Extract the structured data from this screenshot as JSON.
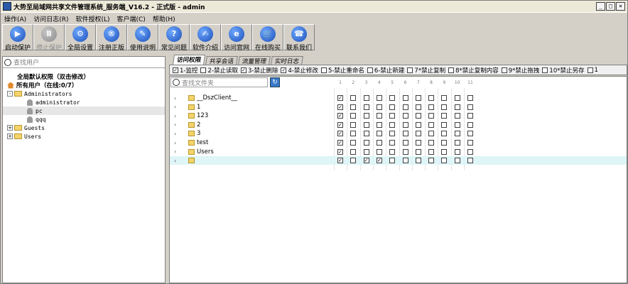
{
  "window": {
    "title": "大势至局域网共享文件管理系统_服务端_V16.2 - 正式版 - admin",
    "controls": [
      "_",
      "□",
      "×"
    ]
  },
  "menu": [
    "操作(A)",
    "访问日志(R)",
    "软件授权(L)",
    "客户端(C)",
    "帮助(H)"
  ],
  "toolbar": [
    {
      "label": "启动保护",
      "icon": "play-icon",
      "glyph": "▶",
      "enabled": true
    },
    {
      "label": "停止保护",
      "icon": "pause-icon",
      "glyph": "Ⅱ",
      "enabled": false
    },
    {
      "label": "全局设置",
      "icon": "gear-icon",
      "glyph": "⚙",
      "enabled": true
    },
    {
      "label": "注册正版",
      "icon": "registered-icon",
      "glyph": "®",
      "enabled": true
    },
    {
      "label": "使用说明",
      "icon": "graduation-cap-icon",
      "glyph": "✎",
      "enabled": true
    },
    {
      "label": "常见问题",
      "icon": "question-icon",
      "glyph": "?",
      "enabled": true
    },
    {
      "label": "软件介绍",
      "icon": "edit-icon",
      "glyph": "✍",
      "enabled": true
    },
    {
      "label": "访问官网",
      "icon": "ie-icon",
      "glyph": "e",
      "enabled": true
    },
    {
      "label": "在线购买",
      "icon": "cart-icon",
      "glyph": "🛒",
      "enabled": true
    },
    {
      "label": "联系我们",
      "icon": "phone-icon",
      "glyph": "☎",
      "enabled": true
    }
  ],
  "left": {
    "search_placeholder": "查找用户",
    "tree": [
      {
        "label": "全局默认权限（双击修改）",
        "level": 0,
        "kind": "none",
        "bold": true
      },
      {
        "label": "所有用户（在线:0/7）",
        "level": 0,
        "kind": "home",
        "bold": true
      },
      {
        "label": "Administrators",
        "level": 0,
        "kind": "folder",
        "expander": "-",
        "mono": true
      },
      {
        "label": "administrator",
        "level": 2,
        "kind": "user",
        "mono": true
      },
      {
        "label": "pc",
        "level": 2,
        "kind": "user",
        "mono": true,
        "selected": true
      },
      {
        "label": "qqq",
        "level": 2,
        "kind": "user",
        "mono": true
      },
      {
        "label": "Guests",
        "level": 0,
        "kind": "folder",
        "expander": "+",
        "mono": true
      },
      {
        "label": "Users",
        "level": 0,
        "kind": "folder",
        "expander": "+",
        "mono": true
      }
    ]
  },
  "tabs": [
    "访问权限",
    "共享会话",
    "流量管理",
    "实时日志"
  ],
  "permissions": [
    {
      "label": "1-监控",
      "checked": true
    },
    {
      "label": "2-禁止读取",
      "checked": false
    },
    {
      "label": "3-禁止删除",
      "checked": true
    },
    {
      "label": "4-禁止修改",
      "checked": true
    },
    {
      "label": "5-禁止重命名",
      "checked": false
    },
    {
      "label": "6-禁止新建",
      "checked": false
    },
    {
      "label": "7*禁止复制",
      "checked": false
    },
    {
      "label": "8*禁止复制内容",
      "checked": false
    },
    {
      "label": "9*禁止拖拽",
      "checked": false
    },
    {
      "label": "10*禁止另存",
      "checked": false
    },
    {
      "label": "1",
      "checked": false
    }
  ],
  "files": {
    "search_placeholder": "查找文件夹",
    "columns": [
      "1",
      "2",
      "3",
      "4",
      "5",
      "6",
      "7",
      "8",
      "9",
      "10",
      "11"
    ],
    "rows": [
      {
        "name": "__DszClient__",
        "checks": [
          1,
          0,
          0,
          0,
          0,
          0,
          0,
          0,
          0,
          0,
          0
        ],
        "selected": false
      },
      {
        "name": "1",
        "checks": [
          1,
          0,
          0,
          0,
          0,
          0,
          0,
          0,
          0,
          0,
          0
        ],
        "selected": false
      },
      {
        "name": "123",
        "checks": [
          1,
          0,
          0,
          0,
          0,
          0,
          0,
          0,
          0,
          0,
          0
        ],
        "selected": false
      },
      {
        "name": "2",
        "checks": [
          1,
          0,
          0,
          0,
          0,
          0,
          0,
          0,
          0,
          0,
          0
        ],
        "selected": false
      },
      {
        "name": "3",
        "checks": [
          1,
          0,
          0,
          0,
          0,
          0,
          0,
          0,
          0,
          0,
          0
        ],
        "selected": false
      },
      {
        "name": "test",
        "checks": [
          1,
          0,
          0,
          0,
          0,
          0,
          0,
          0,
          0,
          0,
          0
        ],
        "selected": false
      },
      {
        "name": "Users",
        "checks": [
          1,
          0,
          0,
          0,
          0,
          0,
          0,
          0,
          0,
          0,
          0
        ],
        "selected": false
      },
      {
        "name": "",
        "checks": [
          1,
          0,
          1,
          1,
          0,
          0,
          0,
          0,
          0,
          0,
          0
        ],
        "selected": true
      }
    ]
  }
}
